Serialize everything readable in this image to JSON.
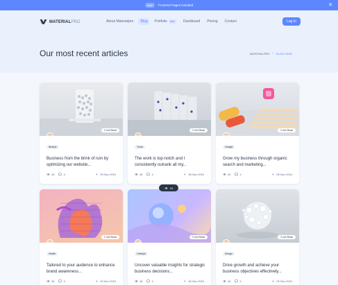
{
  "announcement": {
    "badge": "New",
    "text": "Frontend Pages Included"
  },
  "brand": {
    "bold": "MATERIAL",
    "light": "PRO"
  },
  "nav": {
    "items": [
      {
        "label": "About Materialpro"
      },
      {
        "label": "Blog"
      },
      {
        "label": "Portfolio",
        "badge": "New"
      },
      {
        "label": "Dashboard"
      },
      {
        "label": "Pricing"
      },
      {
        "label": "Contact"
      }
    ],
    "login": "Log In"
  },
  "page": {
    "title": "Our most recent articles",
    "breadcrumb": {
      "home": "MATERIALPRO",
      "current": "BLOG PAGE"
    }
  },
  "floating_pill": {
    "count": "10"
  },
  "articles": [
    {
      "read": "2 min Read",
      "tag": "lifestyle",
      "title": "Business from the brink of ruin by optimizing our website...",
      "views": "45",
      "comments": "4",
      "date": "09 Nov 2024"
    },
    {
      "read": "2 min Read",
      "tag": "Touch",
      "title": "The work is top-notch and I consistently outrank all my...",
      "views": "45",
      "comments": "4",
      "date": "08 Nov 2024"
    },
    {
      "read": "2 min Read",
      "tag": "Gadget",
      "title": "Grow my business through organic search and marketing...",
      "views": "40",
      "comments": "4",
      "date": "05 Nov 2024"
    },
    {
      "read": "2 min Read",
      "tag": "Health",
      "title": "Tailored to your audience to enhance brand awareness...",
      "views": "45",
      "comments": "4",
      "date": "09 Nov 2024"
    },
    {
      "read": "2 min Read",
      "tag": "Lifestyle",
      "title": "Uncover valuable insights for strategic business decisions...",
      "views": "45",
      "comments": "4",
      "date": "08 Nov 2024"
    },
    {
      "read": "2 min Read",
      "tag": "Design",
      "title": "Drive growth and achieve your business objectives effectively...",
      "views": "45",
      "comments": "4",
      "date": "09 Nov 2024"
    }
  ],
  "colors": {
    "primary": "#5d87ff",
    "text": "#2a3547",
    "muted": "#5a6a85",
    "hero": "#eaf1fd"
  }
}
